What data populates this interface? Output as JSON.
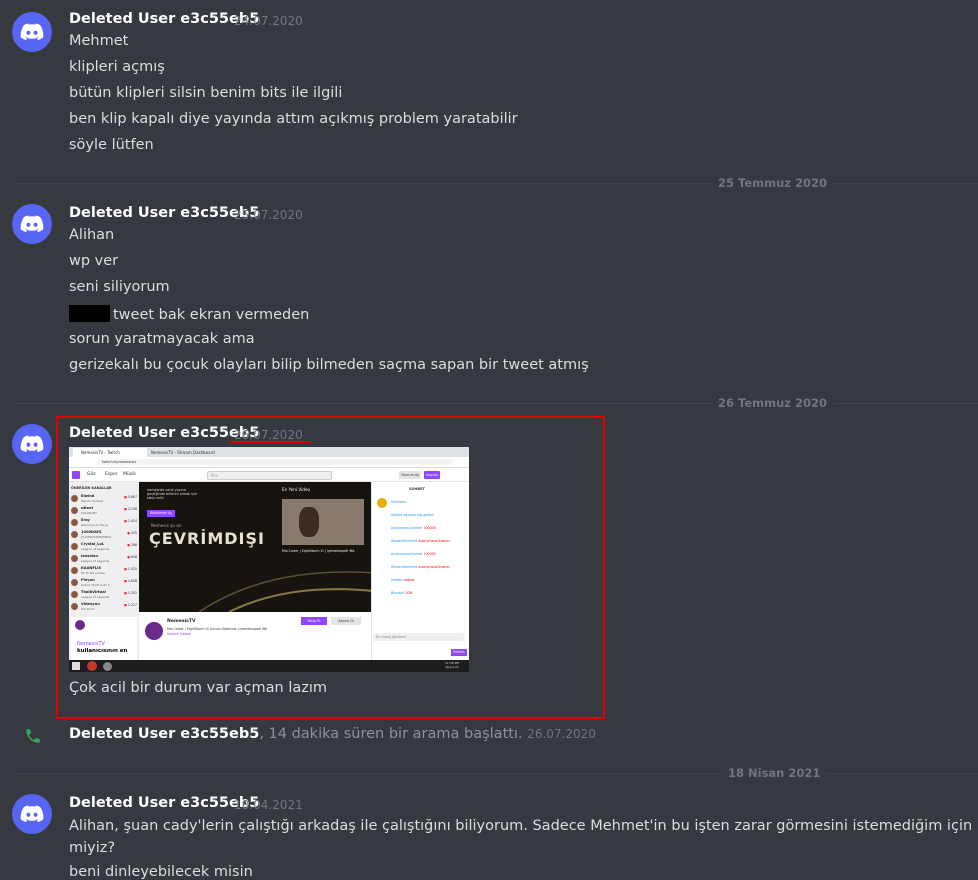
{
  "colors": {
    "background": "#36393f",
    "username": "#ffffff",
    "text": "#dcddde",
    "muted": "#72767d",
    "avatar": "#5865f2",
    "highlight_red": "#e00000",
    "call_green": "#3ba55d"
  },
  "icons": {
    "avatar": "discord-logo-icon",
    "call": "phone-icon"
  },
  "messages": [
    {
      "author": "Deleted User e3c55eb5",
      "time": "24.07.2020",
      "lines": [
        "Mehmet",
        "klipleri açmış",
        "bütün klipleri silsin benim bits ile ilgili",
        "ben klip kapalı diye yayında attım açıkmış problem yaratabilir",
        "söyle lütfen"
      ]
    },
    {
      "author": "Deleted User e3c55eb5",
      "time": "25.07.2020",
      "lines": [
        "Alihan",
        "wp ver",
        "seni siliyorum",
        "tweet bak ekran vermeden",
        "sorun yaratmayacak ama",
        "gerizekalı bu çocuk olayları bilip bilmeden saçma sapan bir tweet atmış"
      ]
    },
    {
      "author": "Deleted User e3c55eb5",
      "time": "26.07.2020",
      "caption": "Çok acil bir durum var açman lazım"
    },
    {
      "author": "Deleted User e3c55eb5",
      "time": "18.04.2021",
      "lines": [
        "Alihan, şuan cady'lerin çalıştığı arkadaş ile çalıştığını biliyorum. Sadece Mehmet'in bu işten zarar görmesini istemediğim için bir uyarı yapm",
        "miyiz?",
        "beni dinleyebilecek misin"
      ]
    }
  ],
  "dividers": [
    "25 Temmuz 2020",
    "26 Temmuz 2020",
    "18 Nisan 2021"
  ],
  "call": {
    "author": "Deleted User e3c55eb5",
    "text": ", 14 dakika süren bir arama başlattı.",
    "time": "26.07.2020"
  },
  "screenshot": {
    "tabs": [
      "NemesisTV - Twitch",
      "NemesisTV - Stream Dashboard"
    ],
    "url": "twitch.tv/nemesistv",
    "nav": [
      "Göz",
      "Espor",
      "Müzik"
    ],
    "search_placeholder": "Ara",
    "buttons": {
      "login": "Oturum Aç",
      "signup": "Kaydol",
      "follow": "Takip Et",
      "subscribe": "Abone Ol",
      "send": "Sohbet",
      "follow_notice": "Bildirimleri Aç"
    },
    "sidebar_title": "ÖNERİLEN KANALLAR",
    "channels": [
      {
        "name": "Elwind",
        "game": "Takvim Sohbet",
        "viewers": "5.667"
      },
      {
        "name": "uNext",
        "game": "VALORANT",
        "viewers": "3.236"
      },
      {
        "name": "Eray",
        "game": "Welcome to the Jg",
        "viewers": "2.924"
      },
      {
        "name": "1000DAYS",
        "game": "PLAYERUNKNOWN'S",
        "viewers": "335"
      },
      {
        "name": "Crystal_LoL",
        "game": "League of Legends",
        "viewers": "288"
      },
      {
        "name": "lanselan",
        "game": "League of Legends",
        "viewers": "648"
      },
      {
        "name": "KAANFLIX",
        "game": "Fit To Fat Anlasy",
        "viewers": "1.025"
      },
      {
        "name": "Pieyon",
        "game": "Grand Theft Auto V",
        "viewers": "4.808"
      },
      {
        "name": "ThalbVirtual",
        "game": "League of Legends",
        "viewers": "1.352"
      },
      {
        "name": "Videoyun",
        "game": "Yok Dont",
        "viewers": "1.227"
      }
    ],
    "offline_small": "Nemesis şu an",
    "offline_big": "ÇEVRİMDIŞI",
    "notice": "nemesistv canlı yayına geçtiğinde bildirim almak için takip edin",
    "new_video": "En Yeni Video",
    "video_title": "Mia Carter | EightStorm VI | lyemeksepeti Yök",
    "channel_name": "NemesisTV",
    "channel_desc": "Mia Carter | EightStorm VI Sunucu Bakımda | lyemeksepeti Yök",
    "channel_sub": "Sadece Sohbet",
    "promo_name": "NemesisTV",
    "promo_text": "kullanıcısının en",
    "chat_title": "SOHBET",
    "chat_lines": [
      {
        "user": "Derbisten",
        "text": ""
      },
      {
        "user": "Sohbet odasına hoş geldin!",
        "text": ""
      },
      {
        "user": "AnonymousCheerer",
        "text": "100000"
      },
      {
        "user": "StreamElements",
        "text": "AnonymousCheerer"
      },
      {
        "user": "AnonymousCheerer",
        "text": "100000"
      },
      {
        "user": "StreamElements",
        "text": "AnonymousCheerer"
      },
      {
        "user": "Mefisto",
        "text": "nabıne"
      },
      {
        "user": "Bluxisen",
        "text": "2GB"
      }
    ],
    "chat_input": "Bir mesaj gönderin",
    "clock_time": "11:56 PM",
    "clock_date": "26-Jul-20"
  }
}
